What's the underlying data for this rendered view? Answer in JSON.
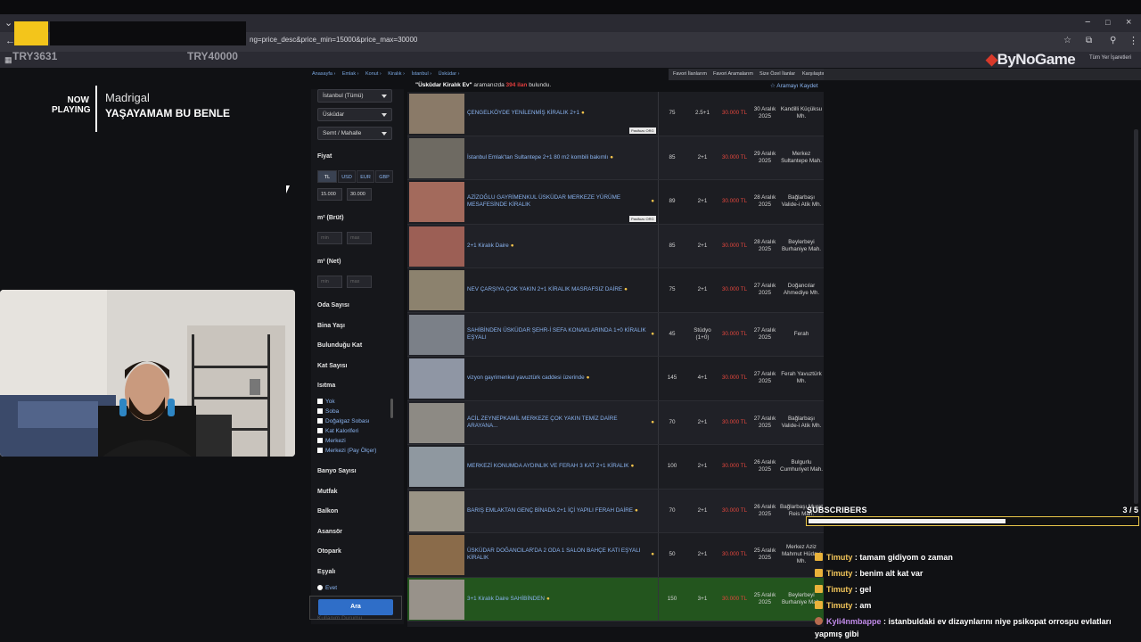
{
  "browser": {
    "url": "ng=price_desc&price_min=15000&price_max=30000",
    "bookmarks_right": "Tüm Yer İşaretleri",
    "tip_left": "TRY3631",
    "tip_right": "TRY40000",
    "brand": "ByNoGame",
    "window_buttons": [
      "−",
      "□",
      "×"
    ]
  },
  "now_playing": {
    "label_line1": "NOW",
    "label_line2": "PLAYING",
    "artist": "Madrigal",
    "song": "YAŞAYAMAM BU BENLE"
  },
  "site": {
    "breadcrumbs": [
      "Anasayfa ›",
      "Emlak ›",
      "Konut ›",
      "Kiralık ›",
      "İstanbul ›",
      "Üsküdar ›"
    ],
    "nav": [
      "Favori İlanlarım",
      "Favori Aramalarım",
      "Size Özel İlanlar",
      "Karşılaştır"
    ],
    "summary_query": "\"Üsküdar Kiralık Ev\"",
    "summary_mid": " aramanızda ",
    "summary_count": "394 ilan",
    "summary_end": " bulundu.",
    "save_search": "☆ Aramayı Kaydet"
  },
  "filters": {
    "city": "İstanbul (Tümü)",
    "district": "Üsküdar",
    "neighborhood": "Semt / Mahalle",
    "price_label": "Fiyat",
    "currencies": [
      "TL",
      "USD",
      "EUR",
      "GBP"
    ],
    "price_min": "15.000",
    "price_max": "30.000",
    "m2_brut_label": "m² (Brüt)",
    "m2_net_label": "m² (Net)",
    "min_ph": "min",
    "max_ph": "max",
    "oda_sayisi": "Oda Sayısı",
    "bina_yasi": "Bina Yaşı",
    "bulundugu_kat": "Bulunduğu Kat",
    "kat_sayisi": "Kat Sayısı",
    "isitma": "Isıtma",
    "heating_options": [
      "Yok",
      "Soba",
      "Doğalgaz Sobası",
      "Kat Kaloriferi",
      "Merkezi",
      "Merkezi (Pay Ölçer)"
    ],
    "banyo_sayisi": "Banyo Sayısı",
    "mutfak": "Mutfak",
    "balkon": "Balkon",
    "asansor": "Asansör",
    "otopark": "Otopark",
    "esyali": "Eşyalı",
    "esyali_option": "Evet",
    "search_button": "Ara",
    "kullanim_durumu": "Kullanım Durumu"
  },
  "listings": [
    {
      "title": "ÇENGELKÖYDE YENİLENMİŞ KİRALIK 2+1",
      "m2": "75",
      "rooms": "2.5+1",
      "price": "30.000 TL",
      "date": "30 Aralık 2025",
      "loc": "Kandilli Küçüksu Mh.",
      "badge": "Pasifuzu ORG",
      "thumb": "#8a7a68"
    },
    {
      "title": "İstanbul Emlak'tan Sultantepe 2+1 80 m2 kombili bakımlı",
      "m2": "85",
      "rooms": "2+1",
      "price": "30.000 TL",
      "date": "29 Aralık 2025",
      "loc": "Merkez Sultantepe Mah.",
      "badge": "",
      "thumb": "#6e6a62"
    },
    {
      "title": "AZİZOĞLU GAYRİMENKUL ÜSKÜDAR MERKEZE YÜRÜME MESAFESİNDE KİRALIK",
      "m2": "89",
      "rooms": "2+1",
      "price": "30.000 TL",
      "date": "28 Aralık 2025",
      "loc": "Bağlarbaşı Valide-i Atik Mh.",
      "badge": "Pasifuzu ORG",
      "thumb": "#a36a5c"
    },
    {
      "title": "2+1 Kiralık Daire",
      "m2": "85",
      "rooms": "2+1",
      "price": "30.000 TL",
      "date": "28 Aralık 2025",
      "loc": "Beylerbeyi Burhaniye Mah.",
      "badge": "",
      "thumb": "#9c5f55"
    },
    {
      "title": "NEV ÇARŞIYA ÇOK YAKIN 2+1 KİRALIK MASRAFSIZ DAİRE",
      "m2": "75",
      "rooms": "2+1",
      "price": "30.000 TL",
      "date": "27 Aralık 2025",
      "loc": "Doğancılar Ahmediye Mh.",
      "badge": "",
      "thumb": "#8c826e"
    },
    {
      "title": "SAHİBİNDEN ÜSKÜDAR ŞEHR-İ SEFA KONAKLARINDA 1+0 KİRALIK EŞYALI",
      "m2": "45",
      "rooms": "Stüdyo (1+0)",
      "price": "30.000 TL",
      "date": "27 Aralık 2025",
      "loc": "Ferah",
      "badge": "",
      "thumb": "#7b8088"
    },
    {
      "title": "vizyon gayrimenkul yavuztürk caddesi üzerinde",
      "m2": "145",
      "rooms": "4+1",
      "price": "30.000 TL",
      "date": "27 Aralık 2025",
      "loc": "Ferah Yavuztürk Mh.",
      "badge": "",
      "thumb": "#8f96a4"
    },
    {
      "title": "ACİL ZEYNEPKAMİL MERKEZE ÇOK YAKIN TEMİZ DAİRE ARAYANA...",
      "m2": "70",
      "rooms": "2+1",
      "price": "30.000 TL",
      "date": "27 Aralık 2025",
      "loc": "Bağlarbaşı Valide-i Atik Mh.",
      "badge": "",
      "thumb": "#8d8a84"
    },
    {
      "title": "MERKEZİ KONUMDA AYDINLIK VE FERAH 3 KAT 2+1 KİRALIK",
      "m2": "100",
      "rooms": "2+1",
      "price": "30.000 TL",
      "date": "26 Aralık 2025",
      "loc": "Bulgurlu Cumhuriyet Mah.",
      "badge": "",
      "thumb": "#8f98a0"
    },
    {
      "title": "BARIŞ EMLAKTAN GENÇ BİNADA 2+1 İÇİ YAPILI FERAH DAİRE",
      "m2": "70",
      "rooms": "2+1",
      "price": "30.000 TL",
      "date": "26 Aralık 2025",
      "loc": "Bağlarbaşı Murat Reis Mah.",
      "badge": "",
      "thumb": "#9a9486"
    },
    {
      "title": "ÜSKÜDAR DOĞANCILAR'DA 2 ODA 1 SALON BAHÇE KATI EŞYALI KİRALIK",
      "m2": "50",
      "rooms": "2+1",
      "price": "30.000 TL",
      "date": "25 Aralık 2025",
      "loc": "Merkez Aziz Mahmut Hüdayi Mh.",
      "badge": "",
      "thumb": "#8a6b4a"
    },
    {
      "title": "3+1 Kiralık Daire SAHİBİNDEN",
      "m2": "150",
      "rooms": "3+1",
      "price": "30.000 TL",
      "date": "25 Aralık 2025",
      "loc": "Beylerbeyi Burhaniye Mah.",
      "badge": "",
      "thumb": "#98928a"
    }
  ],
  "subscribers": {
    "label": "SUBSCRIBERS",
    "count": "3 / 5",
    "progress": 0.6
  },
  "chat": [
    {
      "user": "Timuty",
      "sep": " : ",
      "text": "tamam gidiyom o zaman",
      "style": "gold"
    },
    {
      "user": "Timuty",
      "sep": " : ",
      "text": "benim alt kat var",
      "style": "gold"
    },
    {
      "user": "Timuty",
      "sep": " : ",
      "text": "gel",
      "style": "gold"
    },
    {
      "user": "Timuty",
      "sep": " : ",
      "text": "am",
      "style": "gold"
    },
    {
      "user": "Kyli4nmbappe",
      "sep": " : ",
      "text": "istanbuldaki ev dizaynlarını niye psikopat orrospu evlatları yapmış gibi",
      "style": "purple"
    }
  ],
  "colors": {
    "accent": "#2f6ec8",
    "price": "#e2463d",
    "link": "#8ab4f0",
    "highlight_row": "#23551e",
    "sub_border": "#e9c64a"
  }
}
